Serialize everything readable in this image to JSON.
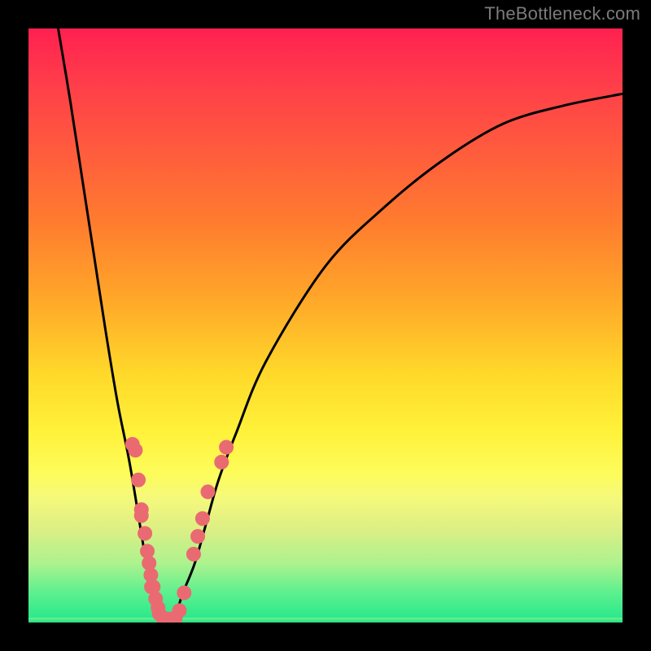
{
  "watermark": {
    "text": "TheBottleneck.com"
  },
  "colors": {
    "frame": "#000000",
    "curve_stroke": "#000000",
    "marker_fill": "#ea6a72",
    "marker_stroke": "#ea6a72",
    "gradient_stops": [
      {
        "pos": 0.0,
        "color": "#ff2050"
      },
      {
        "pos": 0.08,
        "color": "#ff3a4b"
      },
      {
        "pos": 0.2,
        "color": "#ff5a3e"
      },
      {
        "pos": 0.32,
        "color": "#ff7a2f"
      },
      {
        "pos": 0.45,
        "color": "#ffa529"
      },
      {
        "pos": 0.58,
        "color": "#ffd82a"
      },
      {
        "pos": 0.68,
        "color": "#fff23a"
      },
      {
        "pos": 0.75,
        "color": "#fdfc5c"
      },
      {
        "pos": 0.79,
        "color": "#f5f97a"
      },
      {
        "pos": 0.84,
        "color": "#deef84"
      },
      {
        "pos": 0.9,
        "color": "#adf28e"
      },
      {
        "pos": 0.95,
        "color": "#5cf08f"
      },
      {
        "pos": 1.0,
        "color": "#24e78a"
      }
    ]
  },
  "chart_data": {
    "type": "line",
    "title": "",
    "xlabel": "",
    "ylabel": "",
    "xlim": [
      0,
      100
    ],
    "ylim": [
      0,
      100
    ],
    "note": "Background hue maps to y (bottleneck %): red≈high, green≈low. Axes are implied only; no ticks or labels are visible.",
    "series": [
      {
        "name": "bottleneck-curve",
        "x": [
          5,
          7,
          9,
          11,
          13,
          15,
          17,
          19,
          20,
          21,
          22,
          23,
          24,
          25,
          26,
          28,
          30,
          32,
          35,
          40,
          50,
          60,
          70,
          80,
          90,
          100
        ],
        "y": [
          100,
          88,
          75,
          62,
          49,
          37,
          27,
          15,
          9,
          5,
          2,
          0.5,
          0.5,
          2,
          5,
          10,
          17,
          24,
          32,
          44,
          60,
          70,
          78,
          84,
          87,
          89
        ]
      }
    ],
    "markers": {
      "name": "highlighted-points",
      "description": "Salmon-colored dots clustered near the V-minimum region",
      "points": [
        {
          "x": 17.5,
          "y": 30
        },
        {
          "x": 18.0,
          "y": 29
        },
        {
          "x": 18.5,
          "y": 24
        },
        {
          "x": 19.0,
          "y": 19
        },
        {
          "x": 19.0,
          "y": 18
        },
        {
          "x": 19.6,
          "y": 15
        },
        {
          "x": 20.0,
          "y": 12
        },
        {
          "x": 20.3,
          "y": 10
        },
        {
          "x": 20.6,
          "y": 8
        },
        {
          "x": 20.7,
          "y": 6
        },
        {
          "x": 21.0,
          "y": 6
        },
        {
          "x": 21.4,
          "y": 4
        },
        {
          "x": 21.8,
          "y": 2.5
        },
        {
          "x": 22.0,
          "y": 1.5
        },
        {
          "x": 22.7,
          "y": 0.7
        },
        {
          "x": 23.3,
          "y": 0.6
        },
        {
          "x": 24.0,
          "y": 0.6
        },
        {
          "x": 24.7,
          "y": 0.7
        },
        {
          "x": 25.4,
          "y": 2.0
        },
        {
          "x": 26.2,
          "y": 5.0
        },
        {
          "x": 27.8,
          "y": 11.5
        },
        {
          "x": 28.5,
          "y": 14.5
        },
        {
          "x": 29.3,
          "y": 17.5
        },
        {
          "x": 30.2,
          "y": 22.0
        },
        {
          "x": 32.5,
          "y": 27.0
        },
        {
          "x": 33.3,
          "y": 29.5
        }
      ]
    }
  }
}
